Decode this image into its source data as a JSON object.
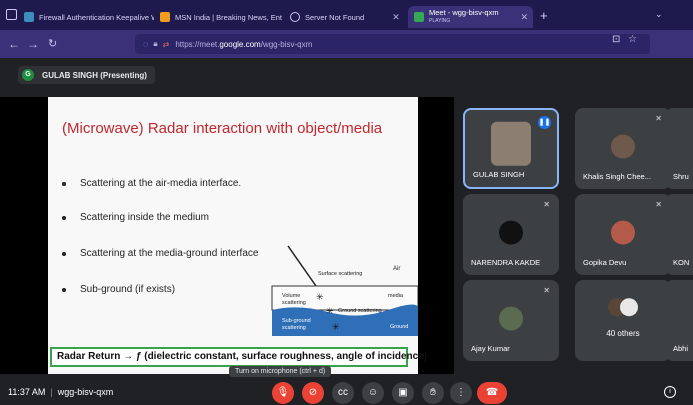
{
  "browser": {
    "tabs": [
      {
        "title": "Firewall Authentication Keepalive W",
        "color": "#3c8dbc"
      },
      {
        "title": "MSN India | Breaking News, Ent",
        "color": "#f29c1f"
      },
      {
        "title": "Server Not Found",
        "color": "#8e86d6"
      },
      {
        "title": "Meet - wgg-bisv-qxm",
        "subtitle": "PLAYING",
        "color": "#34a853"
      }
    ],
    "url_prefix": "https://meet.",
    "url_domain": "google.com",
    "url_path": "/wgg-bisv-qxm"
  },
  "presenter": {
    "initial": "G",
    "label": "GULAB SINGH (Presenting)"
  },
  "slide": {
    "title": "(Microwave) Radar interaction with object/media",
    "bullets": [
      "Scattering at the air-media interface.",
      "Scattering inside the medium",
      "Scattering at the media-ground interface",
      "Sub-ground (if exists)"
    ],
    "diagram": {
      "air": "Air",
      "surface": "Surface scattering",
      "volume_1": "Volume",
      "volume_2": "scattering",
      "media": "media",
      "ground_scattering": "Ground scattering",
      "subground_1": "Sub-ground",
      "subground_2": "scattering",
      "ground": "Ground"
    },
    "radar_return": "Radar Return → ƒ (dielectric constant, surface roughness, angle of incidence)"
  },
  "participants": [
    {
      "name": "GULAB SINGH",
      "speaking": true
    },
    {
      "name": "Khalis Singh Chee..."
    },
    {
      "name": "Shru"
    },
    {
      "name": "NARENDRA KAKDE"
    },
    {
      "name": "Gopika Devu"
    },
    {
      "name": "KON"
    },
    {
      "name": "Ajay Kumar"
    },
    {
      "name": "",
      "others": "40 others"
    },
    {
      "name": "Abhi"
    }
  ],
  "tooltip": "Turn on microphone (ctrl + d)",
  "meeting": {
    "time": "11:37 AM",
    "code": "wgg-bisv-qxm"
  }
}
